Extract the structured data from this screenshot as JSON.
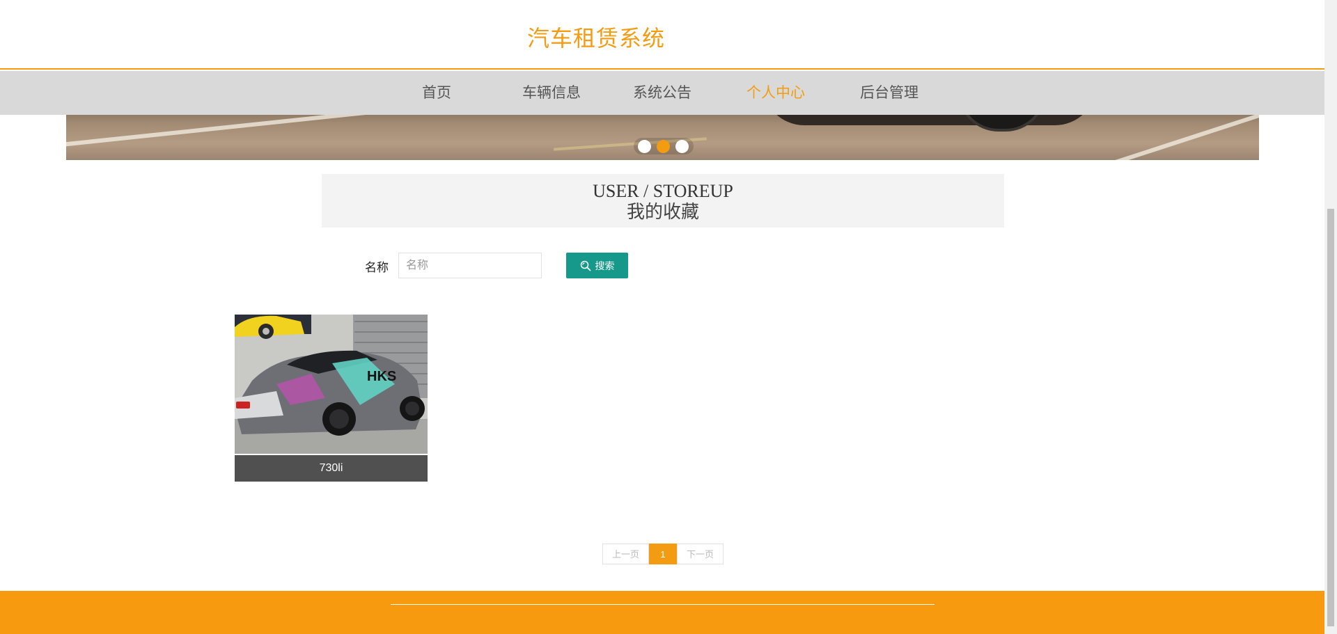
{
  "header": {
    "title": "汽车租赁系统"
  },
  "nav": {
    "items": [
      {
        "label": "首页"
      },
      {
        "label": "车辆信息"
      },
      {
        "label": "系统公告"
      },
      {
        "label": "个人中心"
      },
      {
        "label": "后台管理"
      }
    ],
    "active": "个人中心"
  },
  "banner": {
    "slide_count": 3,
    "active_slide": 2
  },
  "section": {
    "title_en": "USER / STOREUP",
    "title_cn": "我的收藏"
  },
  "search": {
    "label": "名称",
    "placeholder": "名称",
    "button_label": "搜索"
  },
  "favorites": [
    {
      "name": "730li"
    }
  ],
  "pagination": {
    "prev_label": "上一页",
    "current": "1",
    "next_label": "下一页"
  },
  "colors": {
    "accent": "#f39c12",
    "search_button": "#16998a",
    "footer": "#f79a10",
    "nav_bg": "#d9d9d9"
  }
}
